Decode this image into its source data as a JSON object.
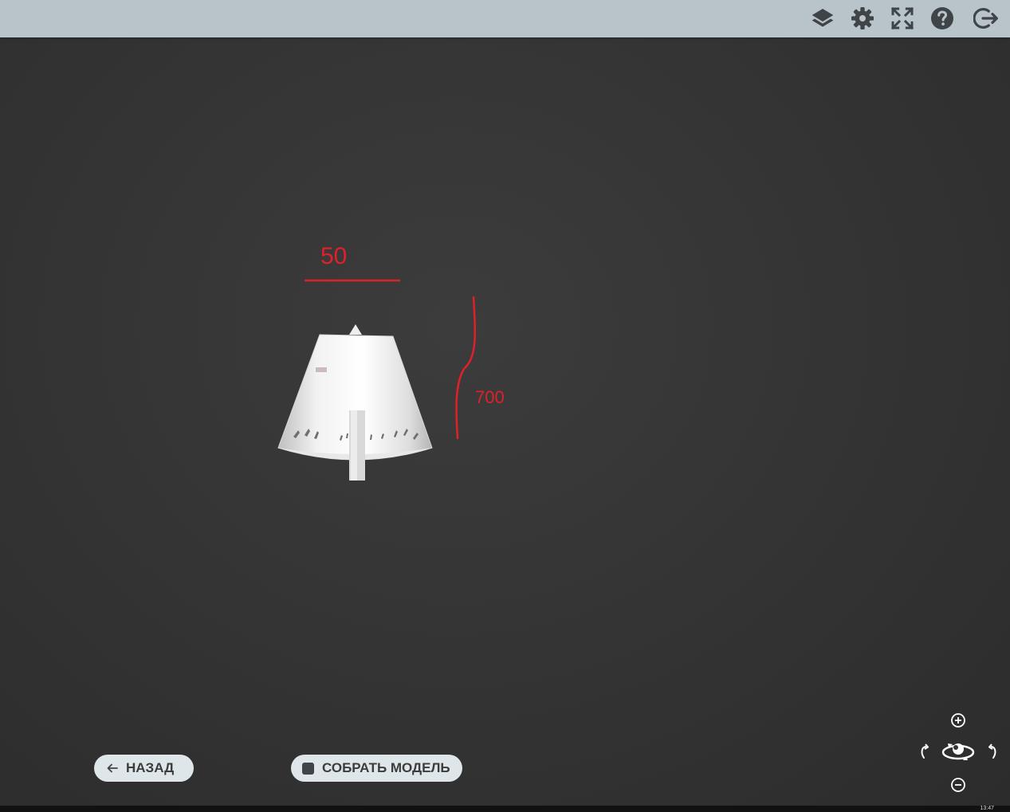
{
  "toolbar": {
    "icons": [
      "layers-icon",
      "settings-gear-icon",
      "fullscreen-icon",
      "help-icon",
      "logout-icon"
    ]
  },
  "annotations": {
    "width_label": "50",
    "height_label": "700"
  },
  "buttons": {
    "back_label": "НАЗАД",
    "assemble_label": "СОБРАТЬ МОДЕЛЬ"
  },
  "nav_controls": [
    "zoom-in-icon",
    "rotate-left-icon",
    "orbit-icon",
    "rotate-right-icon",
    "zoom-out-icon"
  ],
  "taskbar": {
    "clock": "13:47"
  },
  "colors": {
    "annotation_red": "#e0202a",
    "toolbar_bg": "#b9c3ca",
    "button_bg": "#dfe6ea",
    "icon_dark": "#3e4448"
  }
}
